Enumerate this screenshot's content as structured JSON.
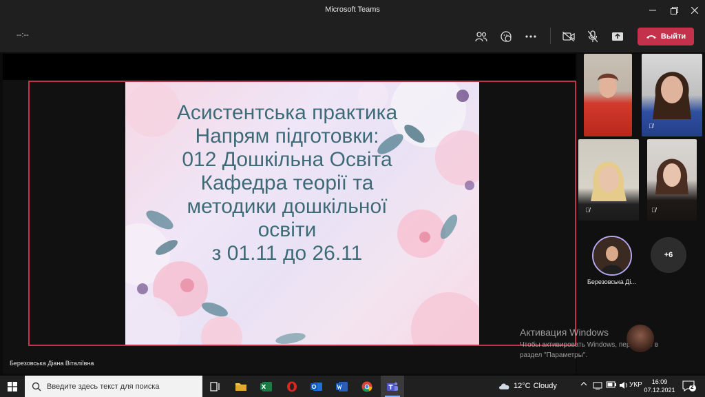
{
  "window": {
    "title": "Microsoft Teams"
  },
  "meeting": {
    "timer": "--:--",
    "leave_label": "Выйти"
  },
  "slide": {
    "lines": [
      "Асистентська практика",
      "Напрям підготовки:",
      "012 Дошкільна Освіта",
      "Кафедра теорії та",
      "методики дошкільної",
      "освіти",
      "з 01.11 до 26.11"
    ]
  },
  "presenter": {
    "name": "Березовська Діана Віталіївна"
  },
  "participants": {
    "avatar_name": "Березовська Ді...",
    "more_count": "+6"
  },
  "watermark": {
    "title": "Активация Windows",
    "line1": "Чтобы активировать Windows, перейдите в",
    "line2": "раздел \"Параметры\"."
  },
  "taskbar": {
    "search_placeholder": "Введите здесь текст для поиска",
    "weather_temp": "12°C",
    "weather_desc": "Cloudy",
    "language": "УКР",
    "time": "16:09",
    "date": "07.12.2021",
    "notification_count": "2"
  },
  "colors": {
    "leave": "#c4314b",
    "share_border": "#c4314b",
    "slide_text": "#3e6a78",
    "avatar_ring": "#b5a8f0"
  }
}
